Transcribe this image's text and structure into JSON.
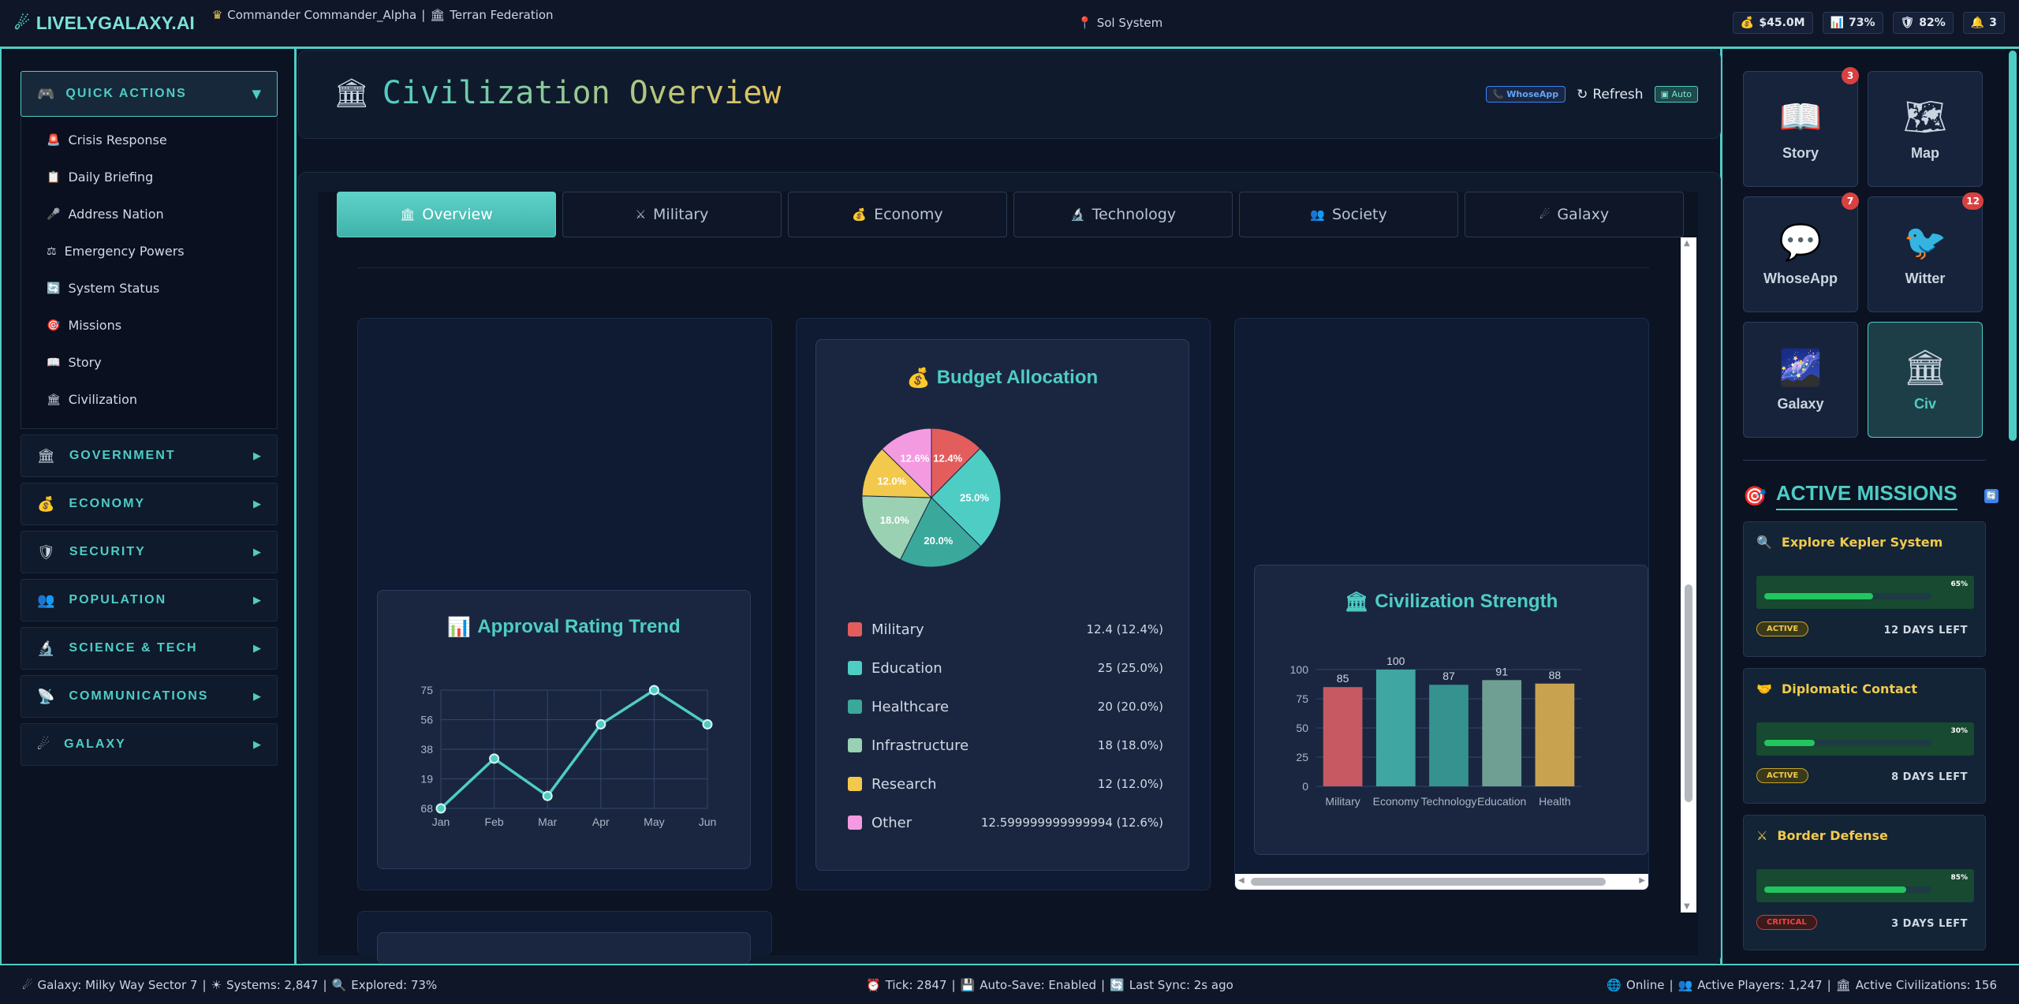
{
  "topbar": {
    "logo": "LIVELYGALAXY.AI",
    "commander": "Commander Commander_Alpha",
    "faction": "Terran Federation",
    "location": "Sol System",
    "stats": [
      {
        "icon": "money-bag-icon",
        "value": "$45.0M"
      },
      {
        "icon": "chart-icon",
        "value": "73%"
      },
      {
        "icon": "shield-icon",
        "value": "82%"
      },
      {
        "icon": "bell-icon",
        "value": "3"
      }
    ]
  },
  "sidebar": {
    "quick_actions_title": "QUICK ACTIONS",
    "quick_actions": [
      {
        "icon": "siren-icon",
        "label": "Crisis Response"
      },
      {
        "icon": "clipboard-icon",
        "label": "Daily Briefing"
      },
      {
        "icon": "microphone-icon",
        "label": "Address Nation"
      },
      {
        "icon": "scales-icon",
        "label": "Emergency Powers"
      },
      {
        "icon": "status-icon",
        "label": "System Status"
      },
      {
        "icon": "target-icon",
        "label": "Missions"
      },
      {
        "icon": "book-icon",
        "label": "Story"
      },
      {
        "icon": "bank-icon",
        "label": "Civilization"
      }
    ],
    "groups": [
      {
        "icon": "bank-icon",
        "label": "GOVERNMENT"
      },
      {
        "icon": "money-bag-icon",
        "label": "ECONOMY"
      },
      {
        "icon": "shield-icon",
        "label": "SECURITY"
      },
      {
        "icon": "people-icon",
        "label": "POPULATION"
      },
      {
        "icon": "microscope-icon",
        "label": "SCIENCE & TECH"
      },
      {
        "icon": "satellite-icon",
        "label": "COMMUNICATIONS"
      },
      {
        "icon": "comet-icon",
        "label": "GALAXY"
      }
    ]
  },
  "header": {
    "title": "Civilization Overview",
    "whoseapp_btn": "WhoseApp",
    "refresh_btn": "Refresh",
    "auto_btn": "Auto"
  },
  "tabs": [
    {
      "icon": "bank-icon",
      "label": "Overview",
      "active": true
    },
    {
      "icon": "swords-icon",
      "label": "Military",
      "active": false
    },
    {
      "icon": "money-bag-icon",
      "label": "Economy",
      "active": false
    },
    {
      "icon": "microscope-icon",
      "label": "Technology",
      "active": false
    },
    {
      "icon": "people-icon",
      "label": "Society",
      "active": false
    },
    {
      "icon": "comet-icon",
      "label": "Galaxy",
      "active": false
    }
  ],
  "approval": {
    "title": "Approval Rating Trend"
  },
  "budget": {
    "title": "Budget Allocation",
    "legend": [
      {
        "label": "Military",
        "value": "12.4 (12.4%)",
        "color": "#e35d5d"
      },
      {
        "label": "Education",
        "value": "25 (25.0%)",
        "color": "#4ecdc4"
      },
      {
        "label": "Healthcare",
        "value": "20 (20.0%)",
        "color": "#3aa89b"
      },
      {
        "label": "Infrastructure",
        "value": "18 (18.0%)",
        "color": "#99d1b2"
      },
      {
        "label": "Research",
        "value": "12 (12.0%)",
        "color": "#f2c94c"
      },
      {
        "label": "Other",
        "value": "12.599999999999994 (12.6%)",
        "color": "#f49ae0"
      }
    ]
  },
  "strength": {
    "title": "Civilization Strength"
  },
  "chart_data": [
    {
      "type": "line",
      "title": "Approval Rating Trend",
      "x": [
        "Jan",
        "Feb",
        "Mar",
        "Apr",
        "May",
        "Jun"
      ],
      "y_ticks": [
        "75",
        "56",
        "38",
        "19",
        "68"
      ],
      "series": [
        {
          "values": [
            68,
            84,
            72,
            95,
            106,
            95
          ]
        }
      ],
      "grid": true
    },
    {
      "type": "pie",
      "title": "Budget Allocation",
      "categories": [
        "Military",
        "Education",
        "Healthcare",
        "Infrastructure",
        "Research",
        "Other"
      ],
      "values": [
        12.4,
        25,
        20,
        18,
        12,
        12.599999999999994
      ],
      "labels": [
        "12.4%",
        "25.0%",
        "20.0%",
        "18.0%",
        "12.0%",
        "12.6%"
      ],
      "colors": [
        "#e35d5d",
        "#4ecdc4",
        "#3aa89b",
        "#99d1b2",
        "#f2c94c",
        "#f49ae0"
      ]
    },
    {
      "type": "bar",
      "title": "Civilization Strength",
      "categories": [
        "Military",
        "Economy",
        "Technology",
        "Education",
        "Health"
      ],
      "values": [
        85,
        100,
        87,
        91,
        88
      ],
      "ylim": [
        0,
        100
      ],
      "y_ticks": [
        "0",
        "25",
        "50",
        "75",
        "100"
      ],
      "colors": [
        "#c65962",
        "#3fa6a2",
        "#36928e",
        "#6f9f93",
        "#c9a24f"
      ],
      "grid": true
    }
  ],
  "apps": [
    {
      "icon": "open-book-icon",
      "label": "Story",
      "badge": "3",
      "active": false
    },
    {
      "icon": "map-icon",
      "label": "Map",
      "badge": "",
      "active": false
    },
    {
      "icon": "speech-bubble-icon",
      "label": "WhoseApp",
      "badge": "7",
      "active": false
    },
    {
      "icon": "bird-icon",
      "label": "Witter",
      "badge": "12",
      "active": false
    },
    {
      "icon": "galaxy-icon",
      "label": "Galaxy",
      "badge": "",
      "active": false
    },
    {
      "icon": "bank-icon",
      "label": "Civ",
      "badge": "",
      "active": true
    }
  ],
  "missions": {
    "title": "ACTIVE MISSIONS",
    "items": [
      {
        "icon": "magnifier-icon",
        "title": "Explore Kepler System",
        "progress": 65,
        "progress_label": "65%",
        "status": "ACTIVE",
        "days": "12 DAYS LEFT"
      },
      {
        "icon": "handshake-icon",
        "title": "Diplomatic Contact",
        "progress": 30,
        "progress_label": "30%",
        "status": "ACTIVE",
        "days": "8 DAYS LEFT"
      },
      {
        "icon": "swords-icon",
        "title": "Border Defense",
        "progress": 85,
        "progress_label": "85%",
        "status": "CRITICAL",
        "days": "3 DAYS LEFT"
      }
    ]
  },
  "footer": {
    "galaxy": "Galaxy: Milky Way Sector 7",
    "systems": "Systems: 2,847",
    "explored": "Explored: 73%",
    "tick": "Tick: 2847",
    "autosave": "Auto-Save: Enabled",
    "last_sync": "Last Sync: 2s ago",
    "online": "Online",
    "active_players": "Active Players: 1,247",
    "active_civs": "Active Civilizations: 156"
  }
}
